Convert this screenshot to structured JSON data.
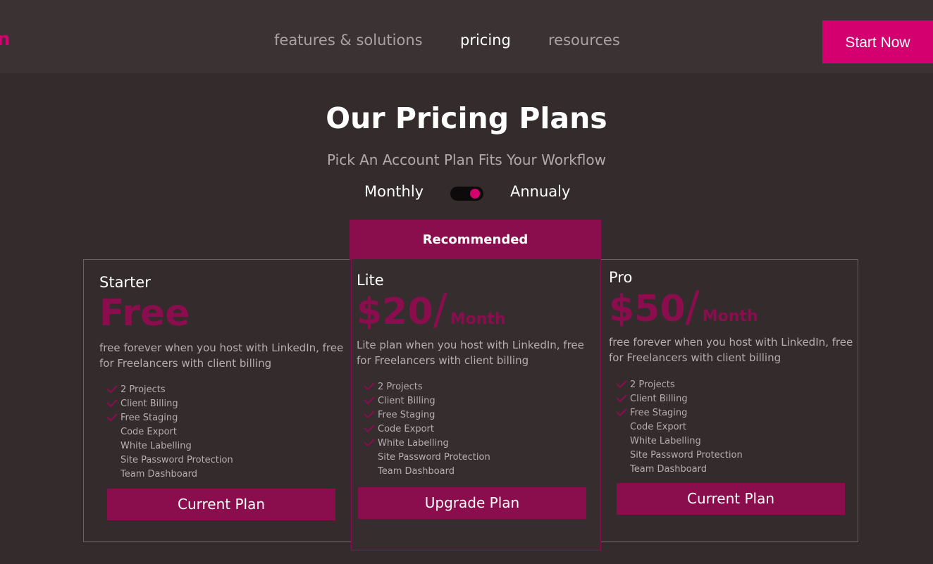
{
  "header": {
    "logo_fragment": "n",
    "nav": [
      {
        "label": "features & solutions",
        "active": false
      },
      {
        "label": "pricing",
        "active": true
      },
      {
        "label": "resources",
        "active": false
      }
    ],
    "cta_label": "Start Now"
  },
  "hero": {
    "title": "Our Pricing Plans",
    "subtitle": "Pick An Account Plan Fits Your Workflow"
  },
  "billing": {
    "monthly_label": "Monthly",
    "annual_label": "Annualy",
    "selected": "Annualy"
  },
  "recommended_label": "Recommended",
  "plans": [
    {
      "name": "Starter",
      "price": "Free",
      "price_unit": "",
      "description": "free forever when you host with LinkedIn, free for Freelancers with client billing",
      "features": [
        {
          "label": "2 Projects",
          "included": true
        },
        {
          "label": "Client Billing",
          "included": true
        },
        {
          "label": "Free Staging",
          "included": true
        },
        {
          "label": "Code Export",
          "included": false
        },
        {
          "label": "White Labelling",
          "included": false
        },
        {
          "label": "Site Password Protection",
          "included": false
        },
        {
          "label": "Team Dashboard",
          "included": false
        }
      ],
      "button_label": "Current Plan"
    },
    {
      "name": "Lite",
      "price": "$20",
      "price_slash": "/",
      "price_unit": "Month",
      "description": "Lite plan when you host with LinkedIn, free for Freelancers with client billing",
      "features": [
        {
          "label": "2 Projects",
          "included": true
        },
        {
          "label": "Client Billing",
          "included": true
        },
        {
          "label": "Free Staging",
          "included": true
        },
        {
          "label": "Code Export",
          "included": true
        },
        {
          "label": "White Labelling",
          "included": true
        },
        {
          "label": "Site Password Protection",
          "included": false
        },
        {
          "label": "Team Dashboard",
          "included": false
        }
      ],
      "button_label": "Upgrade Plan"
    },
    {
      "name": "Pro",
      "price": "$50",
      "price_slash": "/",
      "price_unit": "Month",
      "description": "free forever when you host with LinkedIn, free for Freelancers with client billing",
      "features": [
        {
          "label": "2 Projects",
          "included": true
        },
        {
          "label": "Client Billing",
          "included": true
        },
        {
          "label": "Free Staging",
          "included": true
        },
        {
          "label": "Code Export",
          "included": false
        },
        {
          "label": "White Labelling",
          "included": false
        },
        {
          "label": "Site Password Protection",
          "included": false
        },
        {
          "label": "Team Dashboard",
          "included": false
        }
      ],
      "button_label": "Current Plan"
    }
  ],
  "colors": {
    "background": "#332b2c",
    "header": "#3a3233",
    "accent": "#d4006f",
    "plan_accent": "#8a0d4d"
  }
}
